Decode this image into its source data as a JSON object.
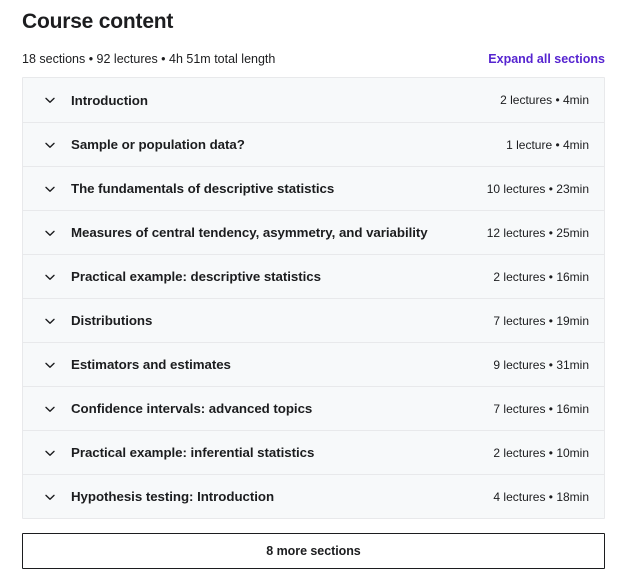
{
  "header": {
    "title": "Course content",
    "summary": "18 sections • 92 lectures • 4h 51m total length",
    "expand_all_label": "Expand all sections",
    "accent_color": "#5624d0",
    "text_color": "#1c1d1f"
  },
  "sections": [
    {
      "title": "Introduction",
      "meta": "2 lectures • 4min",
      "icon": "chevron-down-icon"
    },
    {
      "title": "Sample or population data?",
      "meta": "1 lecture • 4min",
      "icon": "chevron-down-icon"
    },
    {
      "title": "The fundamentals of descriptive statistics",
      "meta": "10 lectures • 23min",
      "icon": "chevron-down-icon"
    },
    {
      "title": "Measures of central tendency, asymmetry, and variability",
      "meta": "12 lectures • 25min",
      "icon": "chevron-down-icon"
    },
    {
      "title": "Practical example: descriptive statistics",
      "meta": "2 lectures • 16min",
      "icon": "chevron-down-icon"
    },
    {
      "title": "Distributions",
      "meta": "7 lectures • 19min",
      "icon": "chevron-down-icon"
    },
    {
      "title": "Estimators and estimates",
      "meta": "9 lectures • 31min",
      "icon": "chevron-down-icon"
    },
    {
      "title": "Confidence intervals: advanced topics",
      "meta": "7 lectures • 16min",
      "icon": "chevron-down-icon"
    },
    {
      "title": "Practical example: inferential statistics",
      "meta": "2 lectures • 10min",
      "icon": "chevron-down-icon"
    },
    {
      "title": "Hypothesis testing: Introduction",
      "meta": "4 lectures • 18min",
      "icon": "chevron-down-icon"
    }
  ],
  "footer": {
    "more_sections_label": "8 more sections"
  }
}
